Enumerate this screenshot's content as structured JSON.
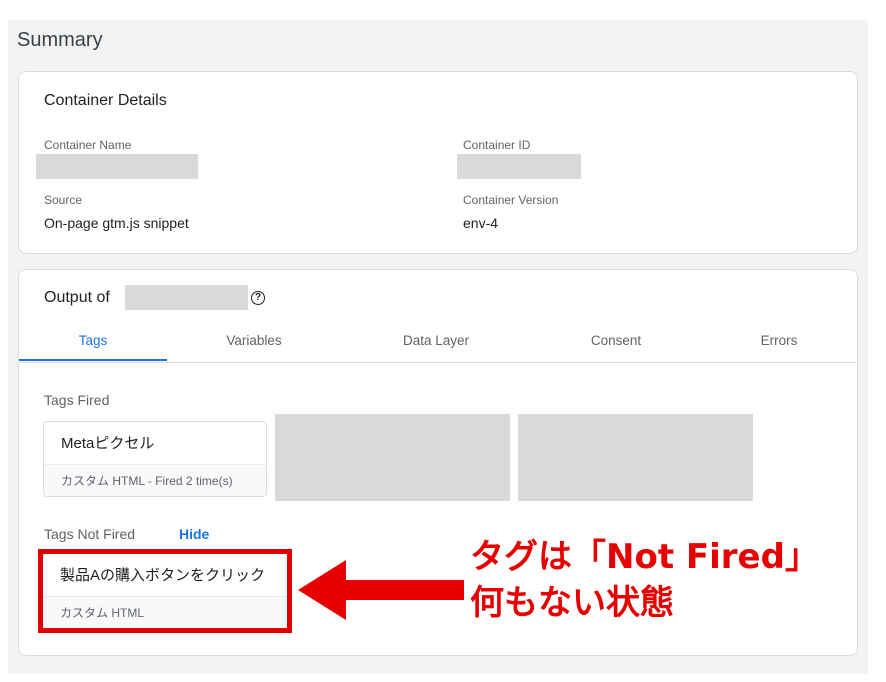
{
  "summary": {
    "title": "Summary"
  },
  "container_details": {
    "title": "Container Details",
    "name_label": "Container Name",
    "id_label": "Container ID",
    "source_label": "Source",
    "source_value": "On-page gtm.js snippet",
    "version_label": "Container Version",
    "version_value": "env-4"
  },
  "output": {
    "title_prefix": "Output of",
    "tabs": [
      {
        "label": "Tags",
        "active": true
      },
      {
        "label": "Variables",
        "active": false
      },
      {
        "label": "Data Layer",
        "active": false
      },
      {
        "label": "Consent",
        "active": false
      },
      {
        "label": "Errors",
        "active": false
      }
    ],
    "tags_fired": {
      "label": "Tags Fired",
      "items": [
        {
          "name": "Metaピクセル",
          "detail": "カスタム HTML - Fired 2 time(s)"
        }
      ]
    },
    "tags_not_fired": {
      "label": "Tags Not Fired",
      "hide_label": "Hide",
      "items": [
        {
          "name": "製品Aの購入ボタンをクリック",
          "detail": "カスタム HTML"
        }
      ]
    }
  },
  "annotation": {
    "line1": "タグは「Not Fired」",
    "line2": "何もない状態",
    "color": "#e60000"
  },
  "colors": {
    "accent": "#1a73e8",
    "highlight": "#e00000"
  }
}
